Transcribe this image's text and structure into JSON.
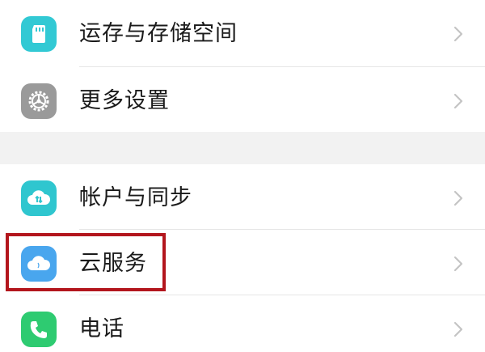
{
  "settings": {
    "items": [
      {
        "label": "运存与存储空间",
        "icon": "sd-card-icon",
        "color": "#32c9d4"
      },
      {
        "label": "更多设置",
        "icon": "gear-icon",
        "color": "#9a9a9a"
      },
      {
        "label": "帐户与同步",
        "icon": "cloud-sync-icon",
        "color": "#2fc6cf"
      },
      {
        "label": "云服务",
        "icon": "cloud-icon",
        "color": "#49a6ee"
      },
      {
        "label": "电话",
        "icon": "phone-icon",
        "color": "#2ecb71"
      }
    ]
  },
  "colors": {
    "highlight_border": "#b3161d",
    "section_gap": "#f2f2f2",
    "chevron": "#c4c4c4"
  }
}
